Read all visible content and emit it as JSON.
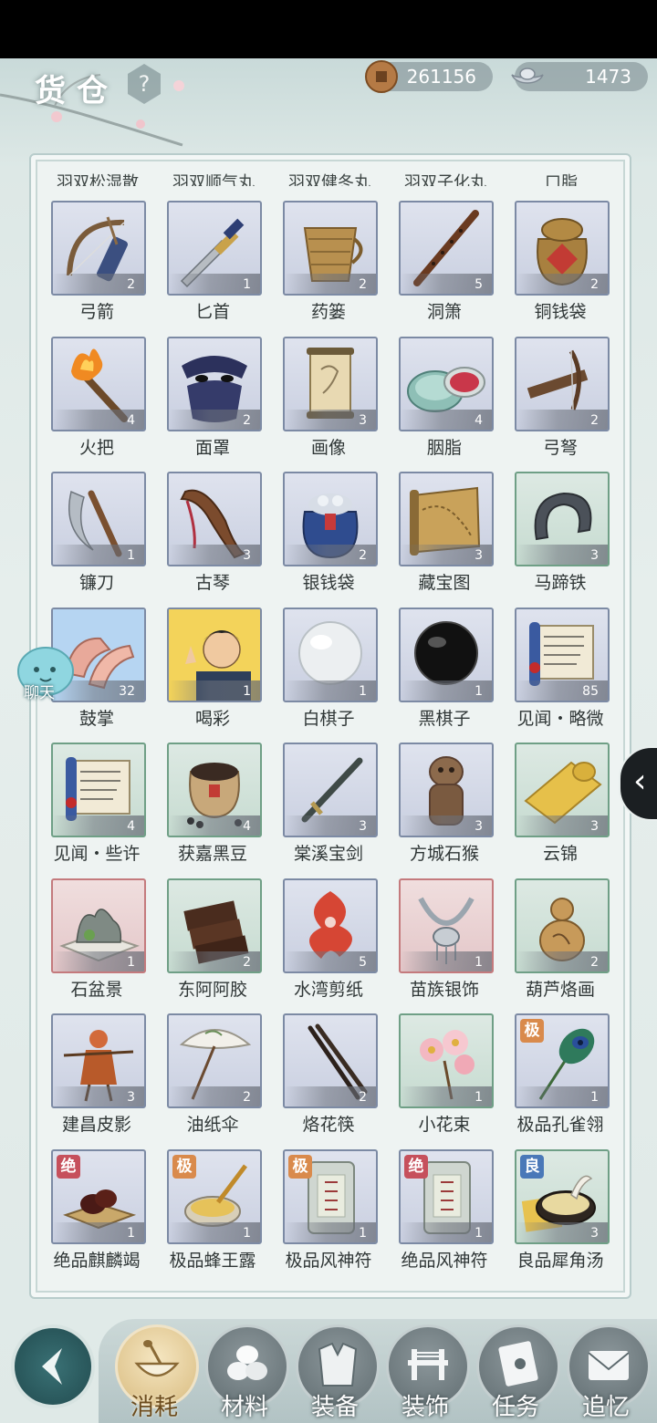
{
  "header": {
    "title": "货仓",
    "help_label": "?",
    "coins": "261156",
    "silver": "1473"
  },
  "partial_row_labels": [
    "羽双松湿散",
    "羽双顺气丸",
    "羽双健冬丸",
    "羽双子化丸",
    "口脂"
  ],
  "items": [
    {
      "name": "弓箭",
      "count": "2",
      "frame": "blue",
      "icon": "bow-arrows-icon"
    },
    {
      "name": "匕首",
      "count": "1",
      "frame": "blue",
      "icon": "dagger-icon"
    },
    {
      "name": "药篓",
      "count": "2",
      "frame": "blue",
      "icon": "herb-basket-icon"
    },
    {
      "name": "洞箫",
      "count": "5",
      "frame": "blue",
      "icon": "flute-icon"
    },
    {
      "name": "铜钱袋",
      "count": "2",
      "frame": "blue",
      "icon": "copper-coin-bag-icon"
    },
    {
      "name": "火把",
      "count": "4",
      "frame": "blue",
      "icon": "torch-icon"
    },
    {
      "name": "面罩",
      "count": "2",
      "frame": "blue",
      "icon": "face-mask-icon"
    },
    {
      "name": "画像",
      "count": "3",
      "frame": "blue",
      "icon": "portrait-scroll-icon"
    },
    {
      "name": "胭脂",
      "count": "4",
      "frame": "blue",
      "icon": "rouge-box-icon"
    },
    {
      "name": "弓弩",
      "count": "2",
      "frame": "blue",
      "icon": "crossbow-icon"
    },
    {
      "name": "镰刀",
      "count": "1",
      "frame": "blue",
      "icon": "sickle-icon"
    },
    {
      "name": "古琴",
      "count": "3",
      "frame": "blue",
      "icon": "guqin-icon"
    },
    {
      "name": "银钱袋",
      "count": "2",
      "frame": "blue",
      "icon": "silver-coin-bag-icon"
    },
    {
      "name": "藏宝图",
      "count": "3",
      "frame": "blue",
      "icon": "treasure-map-icon"
    },
    {
      "name": "马蹄铁",
      "count": "3",
      "frame": "green",
      "icon": "horseshoe-icon"
    },
    {
      "name": "鼓掌",
      "count": "32",
      "frame": "blue",
      "icon": "clapping-hands-icon"
    },
    {
      "name": "喝彩",
      "count": "1",
      "frame": "blue",
      "icon": "cheering-man-icon"
    },
    {
      "name": "白棋子",
      "count": "1",
      "frame": "blue",
      "icon": "white-go-stone-icon"
    },
    {
      "name": "黑棋子",
      "count": "1",
      "frame": "blue",
      "icon": "black-go-stone-icon"
    },
    {
      "name": "见闻・略微",
      "count": "85",
      "frame": "blue",
      "icon": "knowledge-scroll-icon"
    },
    {
      "name": "见闻・些许",
      "count": "4",
      "frame": "green",
      "icon": "knowledge-scroll-icon"
    },
    {
      "name": "获嘉黑豆",
      "count": "4",
      "frame": "green",
      "icon": "black-beans-jar-icon"
    },
    {
      "name": "棠溪宝剑",
      "count": "3",
      "frame": "blue",
      "icon": "sword-icon"
    },
    {
      "name": "方城石猴",
      "count": "3",
      "frame": "blue",
      "icon": "stone-monkey-icon"
    },
    {
      "name": "云锦",
      "count": "3",
      "frame": "green",
      "icon": "brocade-roll-icon"
    },
    {
      "name": "石盆景",
      "count": "1",
      "frame": "red",
      "icon": "stone-bonsai-icon"
    },
    {
      "name": "东阿阿胶",
      "count": "2",
      "frame": "green",
      "icon": "donkey-gelatin-icon"
    },
    {
      "name": "水湾剪纸",
      "count": "5",
      "frame": "blue",
      "icon": "paper-cutting-icon"
    },
    {
      "name": "苗族银饰",
      "count": "1",
      "frame": "red",
      "icon": "silver-necklace-icon"
    },
    {
      "name": "葫芦烙画",
      "count": "2",
      "frame": "green",
      "icon": "gourd-icon"
    },
    {
      "name": "建昌皮影",
      "count": "3",
      "frame": "blue",
      "icon": "shadow-puppet-icon"
    },
    {
      "name": "油纸伞",
      "count": "2",
      "frame": "blue",
      "icon": "paper-umbrella-icon"
    },
    {
      "name": "烙花筷",
      "count": "2",
      "frame": "blue",
      "icon": "chopsticks-icon"
    },
    {
      "name": "小花束",
      "count": "1",
      "frame": "green",
      "icon": "flower-bouquet-icon"
    },
    {
      "name": "极品孔雀翎",
      "count": "1",
      "frame": "blue",
      "icon": "peacock-feather-icon",
      "grade": "极",
      "grade_color": "#d98a4c"
    },
    {
      "name": "绝品麒麟竭",
      "count": "1",
      "frame": "blue",
      "icon": "dragon-blood-resin-icon",
      "grade": "绝",
      "grade_color": "#c6505c"
    },
    {
      "name": "极品蜂王露",
      "count": "1",
      "frame": "blue",
      "icon": "royal-jelly-icon",
      "grade": "极",
      "grade_color": "#d98a4c"
    },
    {
      "name": "极品风神符",
      "count": "1",
      "frame": "blue",
      "icon": "wind-talisman-icon",
      "grade": "极",
      "grade_color": "#d98a4c"
    },
    {
      "name": "绝品风神符",
      "count": "1",
      "frame": "blue",
      "icon": "wind-talisman-icon",
      "grade": "绝",
      "grade_color": "#c6505c"
    },
    {
      "name": "良品犀角汤",
      "count": "3",
      "frame": "green",
      "icon": "rhino-horn-soup-icon",
      "grade": "良",
      "grade_color": "#4a78b8"
    }
  ],
  "chat": {
    "label": "聊天"
  },
  "side_tab": {
    "glyph": "‹"
  },
  "tabs": [
    {
      "label": "消耗",
      "icon": "bowl-spoon-icon",
      "active": true
    },
    {
      "label": "材料",
      "icon": "materials-icon",
      "active": false
    },
    {
      "label": "装备",
      "icon": "robe-icon",
      "active": false
    },
    {
      "label": "装饰",
      "icon": "bridge-decor-icon",
      "active": false
    },
    {
      "label": "任务",
      "icon": "task-book-icon",
      "active": false
    },
    {
      "label": "追忆",
      "icon": "letter-icon",
      "active": false
    }
  ],
  "colors": {
    "frame_blue": "#7c8aa4",
    "frame_green": "#6f9f86",
    "frame_red": "#c47a7d",
    "tab_active": "#e1c893",
    "back_button": "#2b5a5e"
  }
}
